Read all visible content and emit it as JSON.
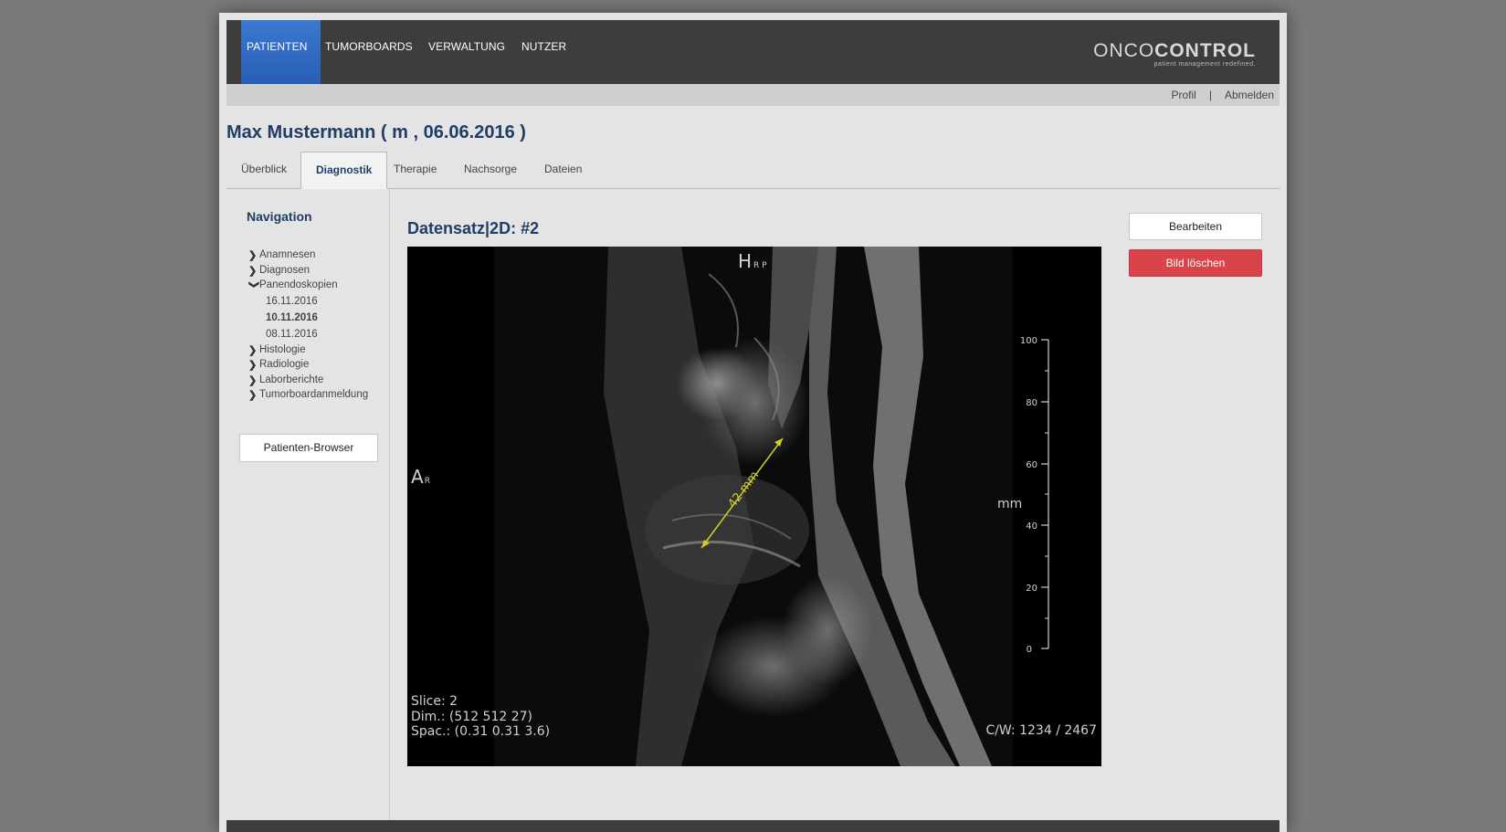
{
  "topnav": {
    "items": [
      "PATIENTEN",
      "TUMORBOARDS",
      "VERWALTUNG",
      "NUTZER"
    ],
    "active": "PATIENTEN",
    "logo_main_light": "ONCO",
    "logo_main_bold": "CONTROL",
    "logo_tagline": "patient management redefined."
  },
  "userbar": {
    "profile": "Profil",
    "separator": "|",
    "logout": "Abmelden"
  },
  "patient": {
    "title": "Max Mustermann ( m , 06.06.2016 )"
  },
  "tabs": [
    "Überblick",
    "Diagnostik",
    "Therapie",
    "Nachsorge",
    "Dateien"
  ],
  "active_tab": "Diagnostik",
  "sidebar": {
    "heading": "Navigation",
    "items": [
      {
        "label": "Anamnesen",
        "expanded": false
      },
      {
        "label": "Diagnosen",
        "expanded": false
      },
      {
        "label": "Panendoskopien",
        "expanded": true,
        "children": [
          "16.11.2016",
          "10.11.2016",
          "08.11.2016"
        ],
        "current": "10.11.2016"
      },
      {
        "label": "Histologie",
        "expanded": false
      },
      {
        "label": "Radiologie",
        "expanded": false
      },
      {
        "label": "Laborberichte",
        "expanded": false
      },
      {
        "label": "Tumorboardanmeldung",
        "expanded": false
      }
    ],
    "browser_button": "Patienten-Browser"
  },
  "dataset": {
    "title": "Datensatz|2D: #2",
    "viewer": {
      "orientation_top": "H",
      "orientation_top_sub": "R P",
      "orientation_left": "A",
      "orientation_left_sub": "R",
      "measurement_label": "42 mm",
      "scale_unit": "mm",
      "scale_ticks": [
        "100",
        "80",
        "60",
        "40",
        "20",
        "0"
      ],
      "slice": "Slice: 2",
      "dim": "Dim.: (512 512 27)",
      "spacing": "Spac.: (0.31 0.31 3.6)",
      "cw": "C/W: 1234 / 2467"
    }
  },
  "actions": {
    "edit": "Bearbeiten",
    "delete": "Bild löschen"
  },
  "colors": {
    "brand_blue": "#2458b0",
    "title_blue": "#1f3d66",
    "danger_red": "#d9444a",
    "measure_yellow": "#cfcf2a"
  }
}
